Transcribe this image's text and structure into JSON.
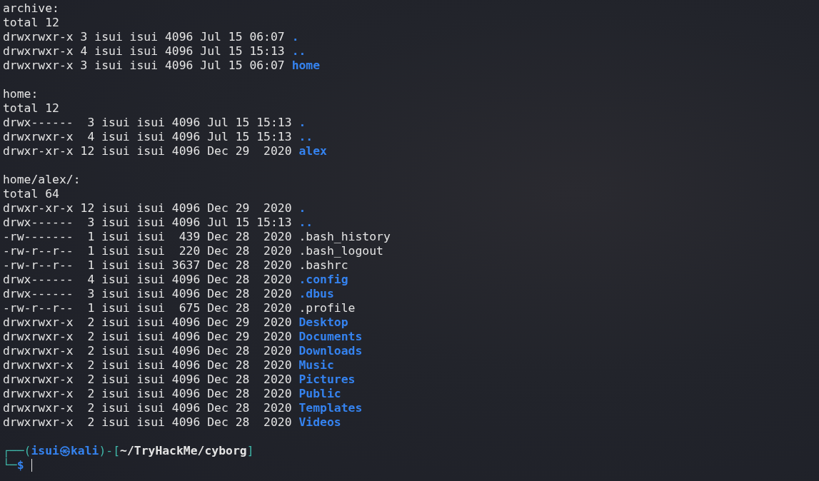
{
  "sections": [
    {
      "header": "archive:",
      "total": "total 12",
      "entries": [
        {
          "info": "drwxrwxr-x 3 isui isui 4096 Jul 15 06:07",
          "name": ".",
          "kind": "dir"
        },
        {
          "info": "drwxrwxr-x 4 isui isui 4096 Jul 15 15:13",
          "name": "..",
          "kind": "dir"
        },
        {
          "info": "drwxrwxr-x 3 isui isui 4096 Jul 15 06:07",
          "name": "home",
          "kind": "dir"
        }
      ]
    },
    {
      "header": "home:",
      "total": "total 12",
      "entries": [
        {
          "info": "drwx------  3 isui isui 4096 Jul 15 15:13",
          "name": ".",
          "kind": "dir"
        },
        {
          "info": "drwxrwxr-x  4 isui isui 4096 Jul 15 15:13",
          "name": "..",
          "kind": "dir"
        },
        {
          "info": "drwxr-xr-x 12 isui isui 4096 Dec 29  2020",
          "name": "alex",
          "kind": "dir"
        }
      ]
    },
    {
      "header": "home/alex/:",
      "total": "total 64",
      "entries": [
        {
          "info": "drwxr-xr-x 12 isui isui 4096 Dec 29  2020",
          "name": ".",
          "kind": "dir"
        },
        {
          "info": "drwx------  3 isui isui 4096 Jul 15 15:13",
          "name": "..",
          "kind": "dir"
        },
        {
          "info": "-rw-------  1 isui isui  439 Dec 28  2020",
          "name": ".bash_history",
          "kind": "file"
        },
        {
          "info": "-rw-r--r--  1 isui isui  220 Dec 28  2020",
          "name": ".bash_logout",
          "kind": "file"
        },
        {
          "info": "-rw-r--r--  1 isui isui 3637 Dec 28  2020",
          "name": ".bashrc",
          "kind": "file"
        },
        {
          "info": "drwx------  4 isui isui 4096 Dec 28  2020",
          "name": ".config",
          "kind": "dir"
        },
        {
          "info": "drwx------  3 isui isui 4096 Dec 28  2020",
          "name": ".dbus",
          "kind": "dir"
        },
        {
          "info": "-rw-r--r--  1 isui isui  675 Dec 28  2020",
          "name": ".profile",
          "kind": "file"
        },
        {
          "info": "drwxrwxr-x  2 isui isui 4096 Dec 29  2020",
          "name": "Desktop",
          "kind": "dir"
        },
        {
          "info": "drwxrwxr-x  2 isui isui 4096 Dec 29  2020",
          "name": "Documents",
          "kind": "dir"
        },
        {
          "info": "drwxrwxr-x  2 isui isui 4096 Dec 28  2020",
          "name": "Downloads",
          "kind": "dir"
        },
        {
          "info": "drwxrwxr-x  2 isui isui 4096 Dec 28  2020",
          "name": "Music",
          "kind": "dir"
        },
        {
          "info": "drwxrwxr-x  2 isui isui 4096 Dec 28  2020",
          "name": "Pictures",
          "kind": "dir"
        },
        {
          "info": "drwxrwxr-x  2 isui isui 4096 Dec 28  2020",
          "name": "Public",
          "kind": "dir"
        },
        {
          "info": "drwxrwxr-x  2 isui isui 4096 Dec 28  2020",
          "name": "Templates",
          "kind": "dir"
        },
        {
          "info": "drwxrwxr-x  2 isui isui 4096 Dec 28  2020",
          "name": "Videos",
          "kind": "dir"
        }
      ]
    }
  ],
  "prompt": {
    "corner_top": "┌──(",
    "user_host": "isui㉿kali",
    "separator": ")-[",
    "path": "~/TryHackMe/cyborg",
    "close": "]",
    "corner_bottom": "└─",
    "symbol": "$"
  }
}
